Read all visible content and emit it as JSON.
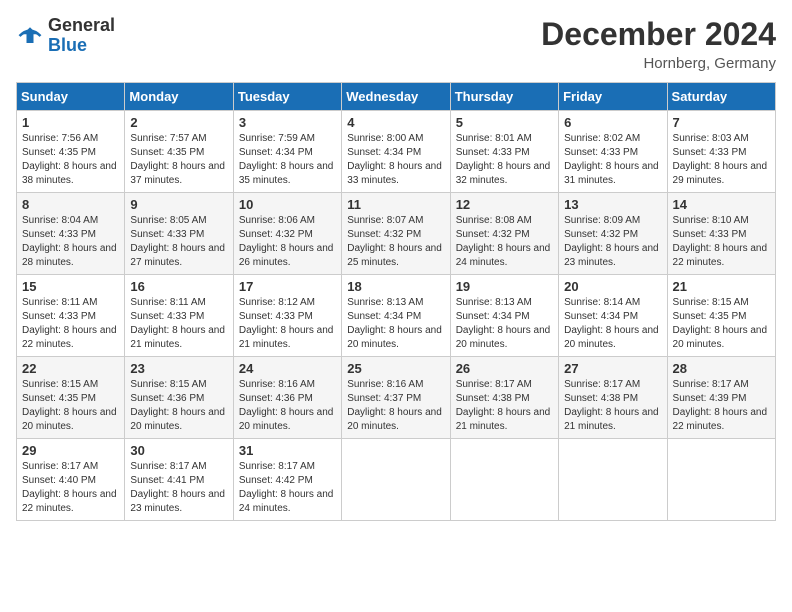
{
  "header": {
    "logo_general": "General",
    "logo_blue": "Blue",
    "month": "December 2024",
    "location": "Hornberg, Germany"
  },
  "weekdays": [
    "Sunday",
    "Monday",
    "Tuesday",
    "Wednesday",
    "Thursday",
    "Friday",
    "Saturday"
  ],
  "weeks": [
    [
      {
        "day": "1",
        "sunrise": "7:56 AM",
        "sunset": "4:35 PM",
        "daylight": "8 hours and 38 minutes."
      },
      {
        "day": "2",
        "sunrise": "7:57 AM",
        "sunset": "4:35 PM",
        "daylight": "8 hours and 37 minutes."
      },
      {
        "day": "3",
        "sunrise": "7:59 AM",
        "sunset": "4:34 PM",
        "daylight": "8 hours and 35 minutes."
      },
      {
        "day": "4",
        "sunrise": "8:00 AM",
        "sunset": "4:34 PM",
        "daylight": "8 hours and 33 minutes."
      },
      {
        "day": "5",
        "sunrise": "8:01 AM",
        "sunset": "4:33 PM",
        "daylight": "8 hours and 32 minutes."
      },
      {
        "day": "6",
        "sunrise": "8:02 AM",
        "sunset": "4:33 PM",
        "daylight": "8 hours and 31 minutes."
      },
      {
        "day": "7",
        "sunrise": "8:03 AM",
        "sunset": "4:33 PM",
        "daylight": "8 hours and 29 minutes."
      }
    ],
    [
      {
        "day": "8",
        "sunrise": "8:04 AM",
        "sunset": "4:33 PM",
        "daylight": "8 hours and 28 minutes."
      },
      {
        "day": "9",
        "sunrise": "8:05 AM",
        "sunset": "4:33 PM",
        "daylight": "8 hours and 27 minutes."
      },
      {
        "day": "10",
        "sunrise": "8:06 AM",
        "sunset": "4:32 PM",
        "daylight": "8 hours and 26 minutes."
      },
      {
        "day": "11",
        "sunrise": "8:07 AM",
        "sunset": "4:32 PM",
        "daylight": "8 hours and 25 minutes."
      },
      {
        "day": "12",
        "sunrise": "8:08 AM",
        "sunset": "4:32 PM",
        "daylight": "8 hours and 24 minutes."
      },
      {
        "day": "13",
        "sunrise": "8:09 AM",
        "sunset": "4:32 PM",
        "daylight": "8 hours and 23 minutes."
      },
      {
        "day": "14",
        "sunrise": "8:10 AM",
        "sunset": "4:33 PM",
        "daylight": "8 hours and 22 minutes."
      }
    ],
    [
      {
        "day": "15",
        "sunrise": "8:11 AM",
        "sunset": "4:33 PM",
        "daylight": "8 hours and 22 minutes."
      },
      {
        "day": "16",
        "sunrise": "8:11 AM",
        "sunset": "4:33 PM",
        "daylight": "8 hours and 21 minutes."
      },
      {
        "day": "17",
        "sunrise": "8:12 AM",
        "sunset": "4:33 PM",
        "daylight": "8 hours and 21 minutes."
      },
      {
        "day": "18",
        "sunrise": "8:13 AM",
        "sunset": "4:34 PM",
        "daylight": "8 hours and 20 minutes."
      },
      {
        "day": "19",
        "sunrise": "8:13 AM",
        "sunset": "4:34 PM",
        "daylight": "8 hours and 20 minutes."
      },
      {
        "day": "20",
        "sunrise": "8:14 AM",
        "sunset": "4:34 PM",
        "daylight": "8 hours and 20 minutes."
      },
      {
        "day": "21",
        "sunrise": "8:15 AM",
        "sunset": "4:35 PM",
        "daylight": "8 hours and 20 minutes."
      }
    ],
    [
      {
        "day": "22",
        "sunrise": "8:15 AM",
        "sunset": "4:35 PM",
        "daylight": "8 hours and 20 minutes."
      },
      {
        "day": "23",
        "sunrise": "8:15 AM",
        "sunset": "4:36 PM",
        "daylight": "8 hours and 20 minutes."
      },
      {
        "day": "24",
        "sunrise": "8:16 AM",
        "sunset": "4:36 PM",
        "daylight": "8 hours and 20 minutes."
      },
      {
        "day": "25",
        "sunrise": "8:16 AM",
        "sunset": "4:37 PM",
        "daylight": "8 hours and 20 minutes."
      },
      {
        "day": "26",
        "sunrise": "8:17 AM",
        "sunset": "4:38 PM",
        "daylight": "8 hours and 21 minutes."
      },
      {
        "day": "27",
        "sunrise": "8:17 AM",
        "sunset": "4:38 PM",
        "daylight": "8 hours and 21 minutes."
      },
      {
        "day": "28",
        "sunrise": "8:17 AM",
        "sunset": "4:39 PM",
        "daylight": "8 hours and 22 minutes."
      }
    ],
    [
      {
        "day": "29",
        "sunrise": "8:17 AM",
        "sunset": "4:40 PM",
        "daylight": "8 hours and 22 minutes."
      },
      {
        "day": "30",
        "sunrise": "8:17 AM",
        "sunset": "4:41 PM",
        "daylight": "8 hours and 23 minutes."
      },
      {
        "day": "31",
        "sunrise": "8:17 AM",
        "sunset": "4:42 PM",
        "daylight": "8 hours and 24 minutes."
      },
      null,
      null,
      null,
      null
    ]
  ],
  "labels": {
    "sunrise": "Sunrise:",
    "sunset": "Sunset:",
    "daylight": "Daylight:"
  }
}
